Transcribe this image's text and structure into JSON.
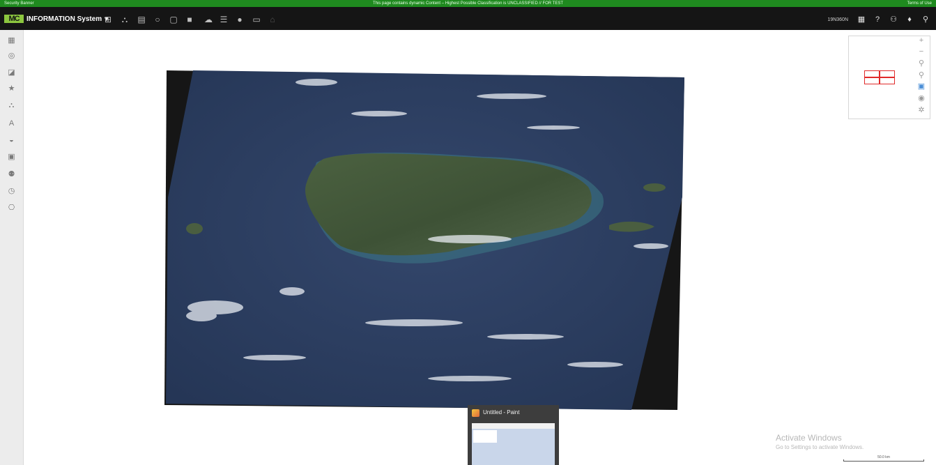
{
  "banner": {
    "left": "Security Banner",
    "center": "This page contains dynamic Content – Highest Possible Classification is UNCLASSIFIED // FOR TEST",
    "right": "Terms of Use"
  },
  "header": {
    "logo": "MC",
    "system_name": "INFORMATION System",
    "toolbar_icons": [
      "map-icon",
      "network-icon",
      "document-icon",
      "chat-icon",
      "report-icon",
      "book-icon",
      "cloud-icon",
      "list-icon",
      "info-icon",
      "screen-icon",
      "lock-icon"
    ],
    "grid_ref": "19N360N",
    "right_icons": [
      "layout-icon",
      "help-icon",
      "user-icon",
      "bell-icon",
      "search-icon"
    ]
  },
  "left_rail": [
    "layers-icon",
    "database-icon",
    "filter-icon",
    "star-icon",
    "network-icon",
    "text-icon",
    "storage-icon",
    "gallery-icon",
    "people-icon",
    "history-icon",
    "tools-icon"
  ],
  "overview": {
    "frame_color": "#e02a2a"
  },
  "zoom_controls": [
    "zoom-in-icon",
    "zoom-out-icon",
    "magnify-icon",
    "zoom-box-icon",
    "select-icon",
    "globe-icon",
    "settings-icon"
  ],
  "paint_window": {
    "title": "Untitled - Paint"
  },
  "watermark": {
    "line1": "Activate Windows",
    "line2": "Go to Settings to activate Windows."
  },
  "scale": {
    "label": "50.0 km"
  },
  "colors": {
    "banner": "#1f8a1f",
    "topbar": "#151515",
    "ocean": "#2d3f62",
    "land": "#45593a"
  }
}
